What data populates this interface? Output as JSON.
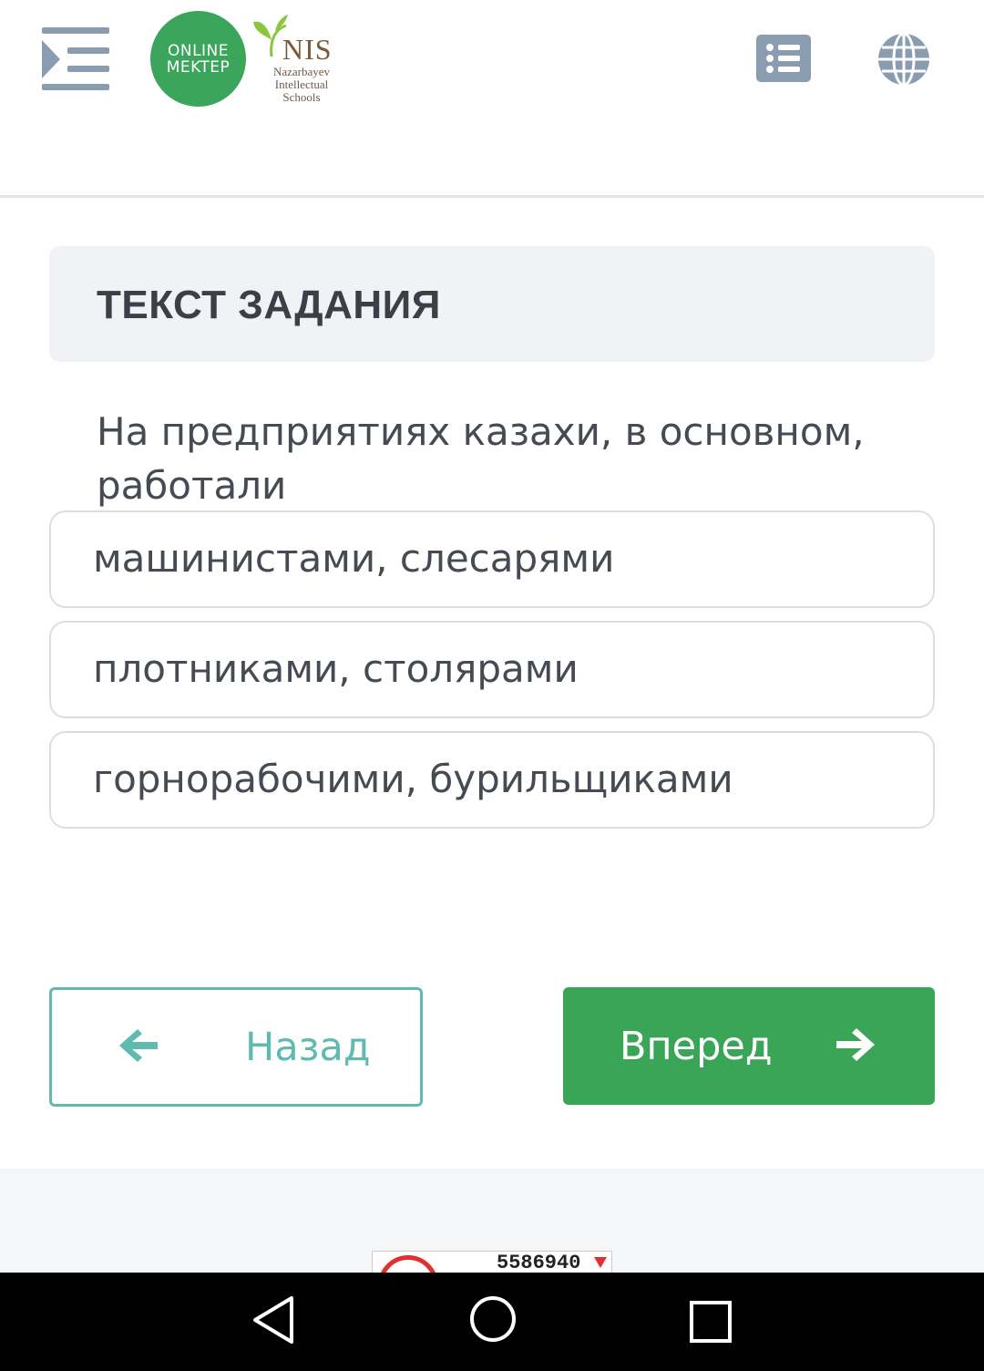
{
  "header": {
    "logo_online_line1": "ONLINE",
    "logo_online_line2": "MEKTEP",
    "logo_nis_title": "NIS",
    "logo_nis_line1": "Nazarbayev",
    "logo_nis_line2": "Intellectual",
    "logo_nis_line3": "Schools",
    "icons": [
      "menu-expand-icon",
      "list-icon",
      "globe-icon"
    ]
  },
  "task": {
    "title": "ТЕКСТ ЗАДАНИЯ",
    "question": "На предприятиях казахи, в основном, работали",
    "answers": [
      "машинистами, слесарями",
      "плотниками, столярами",
      "горнорабочими, бурильщиками"
    ]
  },
  "navigation": {
    "back_label": "Назад",
    "next_label": "Вперед"
  },
  "footer": {
    "counter_value": "5586940"
  },
  "colors": {
    "brand_green": "#3aa556",
    "teal": "#5fbbaf",
    "icon_gray": "#8a9db0"
  }
}
